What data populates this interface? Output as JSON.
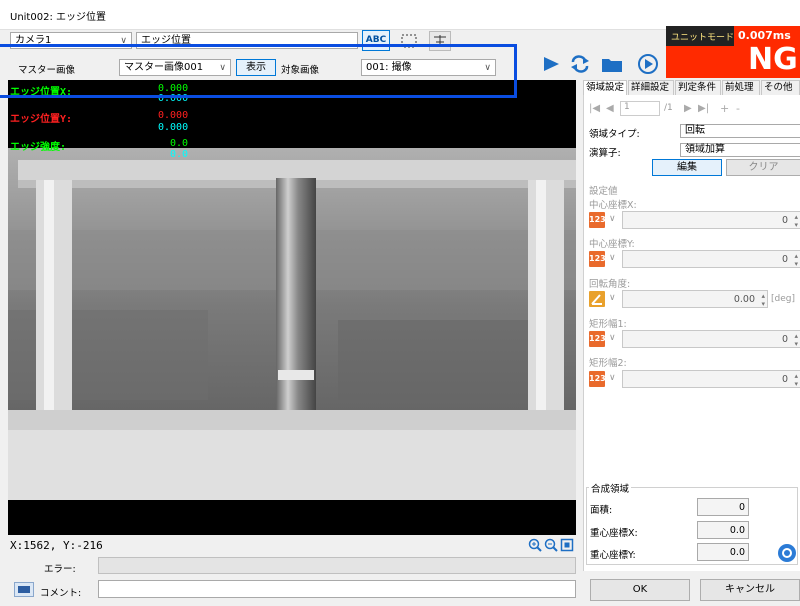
{
  "window": {
    "title": "Unit002: エッジ位置"
  },
  "toolbar": {
    "camera": "カメラ1",
    "unit_name": "エッジ位置",
    "abc_label": "ABC"
  },
  "image_row": {
    "master_label": "マスター画像",
    "master_select": "マスター画像001",
    "show_button": "表示",
    "target_label": "対象画像",
    "target_select": "001: 撮像"
  },
  "status_box": {
    "mode": "ユニットモード",
    "time": "0.007ms",
    "result": "NG"
  },
  "overlay": {
    "edge_x_label": "エッジ位置X:",
    "edge_x_value1": "0.000",
    "edge_x_value2": "0.000",
    "edge_y_label": "エッジ位置Y:",
    "edge_y_value1": "0.000",
    "edge_y_value2": "0.000",
    "edge_str_label": "エッジ強度:",
    "edge_str_value1": "0.0",
    "edge_str_value2": "0.0"
  },
  "coords": "X:1562, Y:-216",
  "bottom": {
    "error_label": "エラー:",
    "comment_label": "コメント:",
    "ok": "OK",
    "cancel": "キャンセル"
  },
  "tabs": [
    "領域設定",
    "詳細設定",
    "判定条件",
    "前処理",
    "その他"
  ],
  "nav": {
    "page_value": "1",
    "page_total": "/1",
    "plus": "+",
    "minus": "-"
  },
  "region": {
    "type_label": "領域タイプ:",
    "type_value": "回転",
    "op_label": "演算子:",
    "op_value": "領域加算",
    "edit_button": "編集",
    "clear_button": "クリア"
  },
  "settings": {
    "group_label": "設定値",
    "center_x": {
      "label": "中心座標X:",
      "value": "0"
    },
    "center_y": {
      "label": "中心座標Y:",
      "value": "0"
    },
    "rotation": {
      "label": "回転角度:",
      "value": "0.00",
      "unit": "[deg]"
    },
    "width1": {
      "label": "矩形幅1:",
      "value": "0"
    },
    "width2": {
      "label": "矩形幅2:",
      "value": "0"
    },
    "int_icon": "123"
  },
  "composite": {
    "group_label": "合成領域",
    "area": {
      "label": "面積:",
      "value": "0"
    },
    "cx": {
      "label": "重心座標X:",
      "value": "0.0"
    },
    "cy": {
      "label": "重心座標Y:",
      "value": "0.0"
    }
  },
  "colors": {
    "highlight": "#0a4de0",
    "ng_bg": "#ff2a00",
    "ng_header": "#222222",
    "label_green": "#00ff00",
    "label_red": "#ff2020",
    "label_cyan": "#00ffff",
    "accent_blue": "#0078d7"
  }
}
